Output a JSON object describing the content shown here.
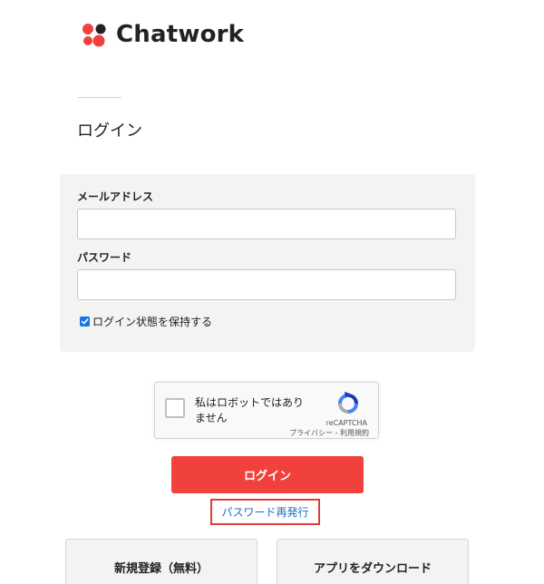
{
  "brand": {
    "name": "Chatwork",
    "colors": {
      "accent": "#f0413d",
      "link": "#1b6ec2",
      "logo_dark": "#222222"
    }
  },
  "page": {
    "title": "ログイン"
  },
  "form": {
    "email": {
      "label": "メールアドレス",
      "value": ""
    },
    "password": {
      "label": "パスワード",
      "value": ""
    },
    "remember": {
      "label": "ログイン状態を保持する",
      "checked": true
    }
  },
  "recaptcha": {
    "label": "私はロボットではありません",
    "brand": "reCAPTCHA",
    "privacy_link": "プライバシー",
    "separator": "-",
    "terms_link": "利用規約",
    "checked": false
  },
  "actions": {
    "login_label": "ログイン",
    "reset_password_label": "パスワード再発行",
    "signup_label": "新規登録（無料）",
    "download_app_label": "アプリをダウンロード"
  },
  "icons": {
    "logo": "chatwork-logo-icon",
    "checkbox": "checkmark-icon",
    "recaptcha": "recaptcha-logo-icon"
  }
}
